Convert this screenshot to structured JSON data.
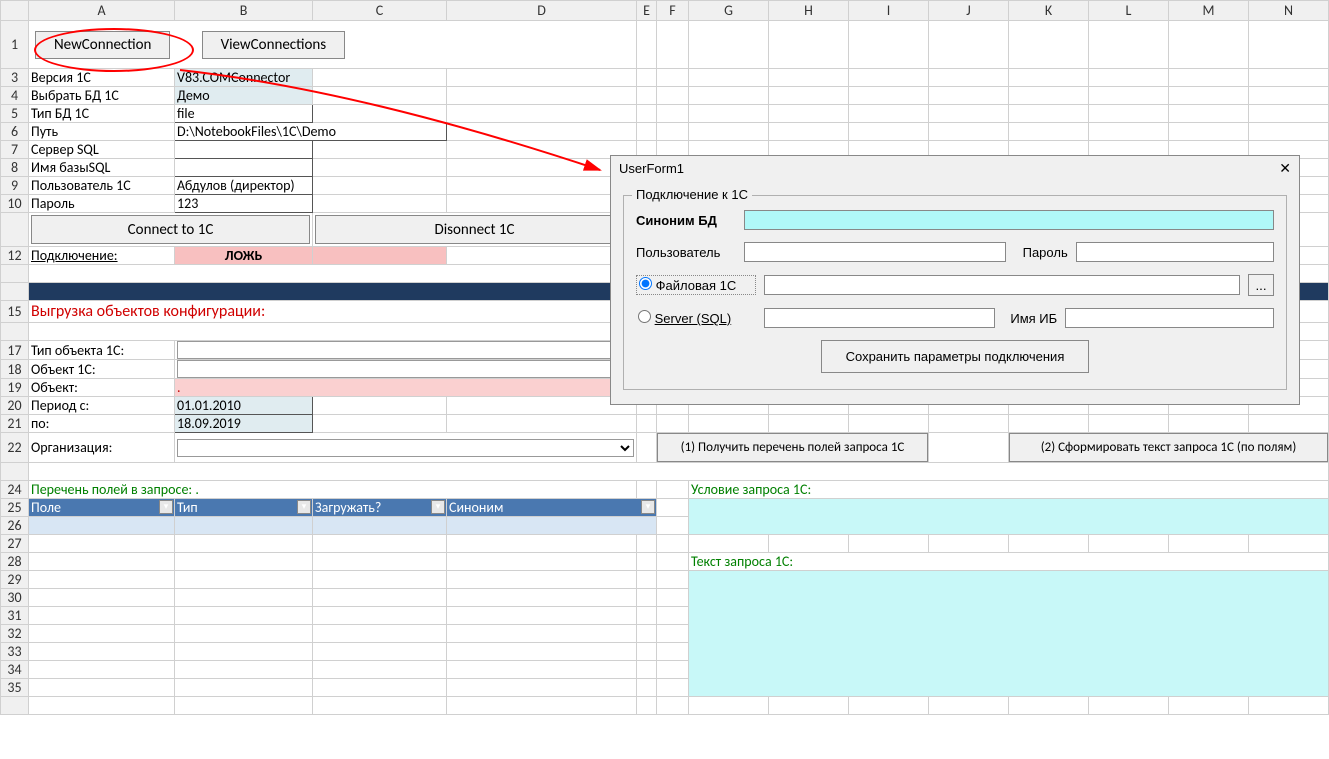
{
  "columns": [
    "A",
    "B",
    "C",
    "D",
    "E",
    "F",
    "G",
    "H",
    "I",
    "J",
    "K",
    "L",
    "M",
    "N"
  ],
  "rows": [
    "1",
    "3",
    "4",
    "5",
    "6",
    "7",
    "8",
    "9",
    "10",
    "",
    "12",
    "",
    "",
    "15",
    "",
    "17",
    "18",
    "19",
    "20",
    "21",
    "22",
    "",
    "24",
    "25",
    "26",
    "27",
    "28",
    "29",
    "30",
    "31",
    "32",
    "33",
    "34",
    "35"
  ],
  "buttons": {
    "new_connection": "NewConnection",
    "view_connections": "ViewConnections",
    "connect": "Connect to 1C",
    "disconnect": "Disonnect 1C",
    "get_fields": "(1) Получить перечень полей запроса 1С",
    "build_query": "(2) Сформировать текст запроса 1С (по полям)"
  },
  "config": {
    "version_label": "Версия 1С",
    "version_value": "V83.COMConnector",
    "db_label": "Выбрать БД 1С",
    "db_value": "Демо",
    "type_label": "Тип БД 1С",
    "type_value": "file",
    "path_label": "Путь",
    "path_value": "D:\\NotebookFiles\\1C\\Demo",
    "sqlserver_label": "Сервер SQL",
    "sqlserver_value": "",
    "sqldb_label": "Имя базыSQL",
    "sqldb_value": "",
    "user_label": "Пользователь 1С",
    "user_value": "Абдулов (директор)",
    "pass_label": "Пароль",
    "pass_value": "123"
  },
  "connection": {
    "label": "Подключение:",
    "status": "ЛОЖЬ"
  },
  "export": {
    "title": "Выгрузка объектов конфигурации:",
    "type_label": "Тип объекта 1С:",
    "object1c_label": "Объект 1С:",
    "object_label": "Объект:",
    "object_value": ".",
    "period_from_label": "Период с:",
    "period_from_value": "01.01.2010",
    "period_to_label": "по:",
    "period_to_value": "18.09.2019",
    "org_label": "Организация:"
  },
  "fields_table": {
    "title": "Перечень полей в запросе: .",
    "headers": [
      "Поле",
      "Тип",
      "Загружать?",
      "Синоним"
    ]
  },
  "query": {
    "cond_label": "Условие запроса 1С:",
    "text_label": "Текст запроса 1С:"
  },
  "userform": {
    "title": "UserForm1",
    "frame_title": "Подключение к 1С",
    "synonym_label": "Синоним БД",
    "user_label": "Пользователь",
    "pass_label": "Пароль",
    "file_label": "Файловая 1С",
    "server_label": "Server (SQL)",
    "dbname_label": "Имя ИБ",
    "browse": "...",
    "save": "Сохранить параметры подключения"
  }
}
